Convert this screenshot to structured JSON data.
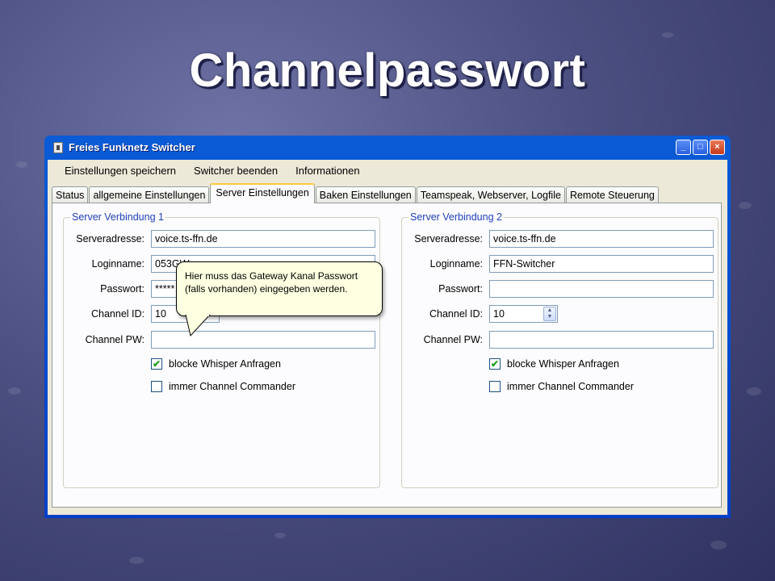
{
  "slide": {
    "title": "Channelpasswort"
  },
  "window": {
    "title": "Freies Funknetz Switcher",
    "controls": {
      "minimize": "_",
      "maximize": "□",
      "close": "×"
    }
  },
  "menu": [
    "Einstellungen speichern",
    "Switcher beenden",
    "Informationen"
  ],
  "tabs": [
    "Status",
    "allgemeine Einstellungen",
    "Server Einstellungen",
    "Baken Einstellungen",
    "Teamspeak, Webserver, Logfile",
    "Remote Steuerung"
  ],
  "active_tab": "Server Einstellungen",
  "labels": {
    "server": "Serveradresse:",
    "login": "Loginname:",
    "password": "Passwort:",
    "channel_id": "Channel ID:",
    "channel_pw": "Channel PW:",
    "whisper": "blocke Whisper Anfragen",
    "commander": "immer Channel Commander"
  },
  "group1": {
    "title": "Server Verbindung 1",
    "server": "voice.ts-ffn.de",
    "login": "053GW",
    "password": "*****",
    "channel_id": "10",
    "channel_pw": "",
    "whisper_checked": true,
    "commander_checked": false
  },
  "group2": {
    "title": "Server Verbindung 2",
    "server": "voice.ts-ffn.de",
    "login": "FFN-Switcher",
    "password": "",
    "channel_id": "10",
    "channel_pw": "",
    "whisper_checked": true,
    "commander_checked": false
  },
  "tooltip": {
    "line1": "Hier muss das Gateway Kanal Passwort",
    "line2": "(falls vorhanden) eingegeben werden."
  },
  "icons": {
    "check": "✔",
    "spin_up": "▲",
    "spin_down": "▼"
  }
}
